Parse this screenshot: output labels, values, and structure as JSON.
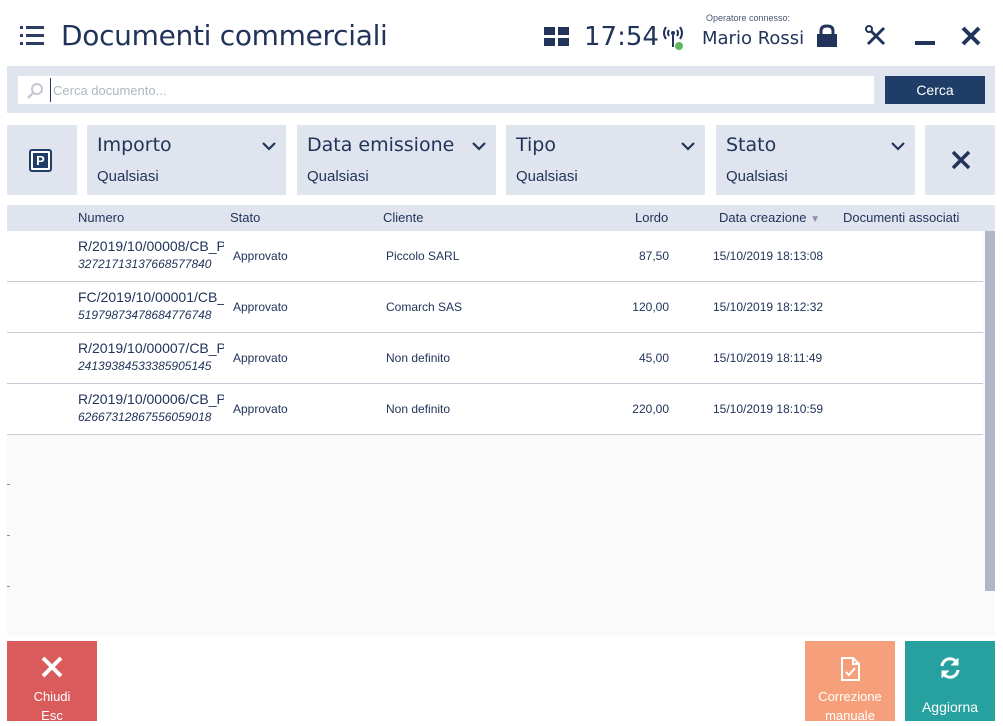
{
  "header": {
    "title": "Documenti commerciali",
    "clock": "17:54",
    "operator_caption": "Operatore connesso:",
    "operator_name": "Mario Rossi"
  },
  "icons": {
    "menu": "hamburger-list-icon",
    "apps": "grid-icon",
    "signal": "connection-signal-icon",
    "lock": "lock-icon",
    "tools": "tools-icon",
    "minimize": "minimize-icon",
    "close": "close-icon",
    "search": "search-icon",
    "parking": "parking-icon",
    "clear": "clear-filters-icon",
    "manual": "document-edit-icon",
    "refresh": "refresh-icon"
  },
  "search": {
    "placeholder": "Cerca documento...",
    "value": "",
    "button_label": "Cerca"
  },
  "filters": [
    {
      "label": "Importo",
      "value": "Qualsiasi"
    },
    {
      "label": "Data emissione",
      "value": "Qualsiasi"
    },
    {
      "label": "Tipo",
      "value": "Qualsiasi"
    },
    {
      "label": "Stato",
      "value": "Qualsiasi"
    }
  ],
  "table": {
    "columns": {
      "numero": "Numero",
      "stato": "Stato",
      "cliente": "Cliente",
      "lordo": "Lordo",
      "data": "Data creazione",
      "associati": "Documenti associati"
    },
    "sort_indicator": "▼",
    "rows": [
      {
        "numero": "R/2019/10/00008/CB_P",
        "code": "32721713137668577840",
        "stato": "Approvato",
        "cliente": "Piccolo SARL",
        "lordo": "87,50",
        "data": "15/10/2019 18:13:08"
      },
      {
        "numero": "FC/2019/10/00001/CB_",
        "code": "51979873478684776748",
        "stato": "Approvato",
        "cliente": "Comarch SAS",
        "lordo": "120,00",
        "data": "15/10/2019 18:12:32"
      },
      {
        "numero": "R/2019/10/00007/CB_P",
        "code": "24139384533385905145",
        "stato": "Approvato",
        "cliente": "Non definito",
        "lordo": "45,00",
        "data": "15/10/2019 18:11:49"
      },
      {
        "numero": "R/2019/10/00006/CB_P",
        "code": "62667312867556059018",
        "stato": "Approvato",
        "cliente": "Non definito",
        "lordo": "220,00",
        "data": "15/10/2019 18:10:59"
      }
    ]
  },
  "footer": {
    "close_label": "Chiudi",
    "close_shortcut": "Esc",
    "manual_line1": "Correzione",
    "manual_line2": "manuale",
    "refresh_label": "Aggiorna"
  },
  "colors": {
    "primary": "#1f3d66",
    "panel": "#dfe4ee",
    "close_button": "#d95b5b",
    "manual_button": "#f5a07b",
    "refresh_button": "#27a0a0",
    "signal_ok": "#5cb85c"
  }
}
